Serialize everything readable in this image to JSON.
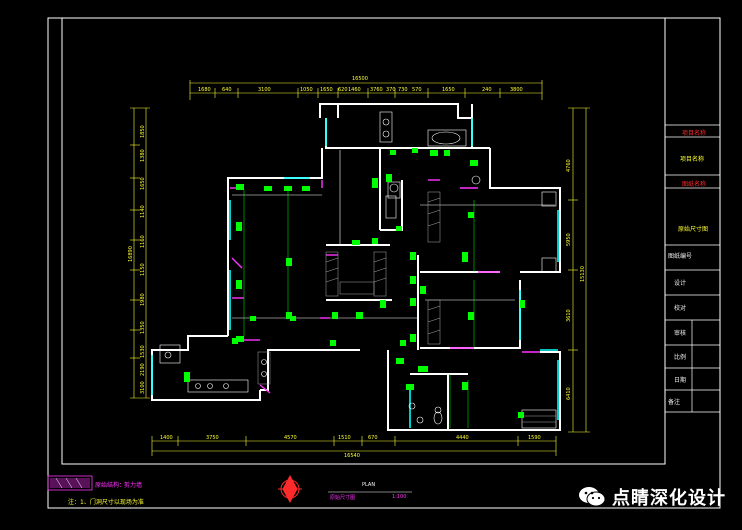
{
  "dimensions_top": {
    "total": "16500",
    "segments": [
      "1680",
      "640",
      "3100",
      "1050",
      "1650",
      "620",
      "1460",
      "3760",
      "370",
      "730",
      "570",
      "1650",
      "240",
      "3800"
    ]
  },
  "dimensions_bottom": {
    "total": "16540",
    "segments": [
      "1400",
      "3750",
      "4570",
      "1510",
      "670",
      "4440",
      "1590"
    ]
  },
  "dimensions_left": {
    "total": "16890",
    "segments": [
      "1850",
      "1380",
      "1650",
      "1140",
      "1160",
      "1150",
      "1980",
      "1350",
      "1530",
      "2190",
      "3100"
    ]
  },
  "dimensions_right": {
    "total": "15130",
    "segments": [
      "4760",
      "5950",
      "3610",
      "6410"
    ]
  },
  "title_block": {
    "cells": [
      {
        "text": "项目名称",
        "color": "red"
      },
      {
        "text": "项目名称",
        "color": "yellow"
      },
      {
        "text": "图纸名称",
        "color": "red"
      },
      {
        "text": "原始尺寸图",
        "color": "yellow"
      },
      {
        "text": "图纸编号",
        "color": "white"
      },
      {
        "text": "设计",
        "color": "white"
      },
      {
        "text": "校对",
        "color": "white"
      },
      {
        "text": "审核",
        "color": "white"
      },
      {
        "text": "比例",
        "color": "white"
      },
      {
        "text": "日期",
        "color": "white"
      },
      {
        "text": "备注",
        "color": "white"
      }
    ]
  },
  "legend": {
    "label": "原始结构：",
    "value": "剪力墙",
    "note": "注：1、门洞尺寸以现场为准"
  },
  "plan_label": {
    "title": "原始尺寸图",
    "scale": "1:100",
    "heading": "PLAN"
  },
  "watermark": {
    "text": "点睛深化设计",
    "icon": "wechat-icon"
  },
  "colors": {
    "background": "#000000",
    "wall": "#ffffff",
    "column": "#00ff00",
    "window": "#00ffff",
    "door": "#ff33ff",
    "dimension": "#ffff33",
    "title_red": "#ff2a2a"
  }
}
